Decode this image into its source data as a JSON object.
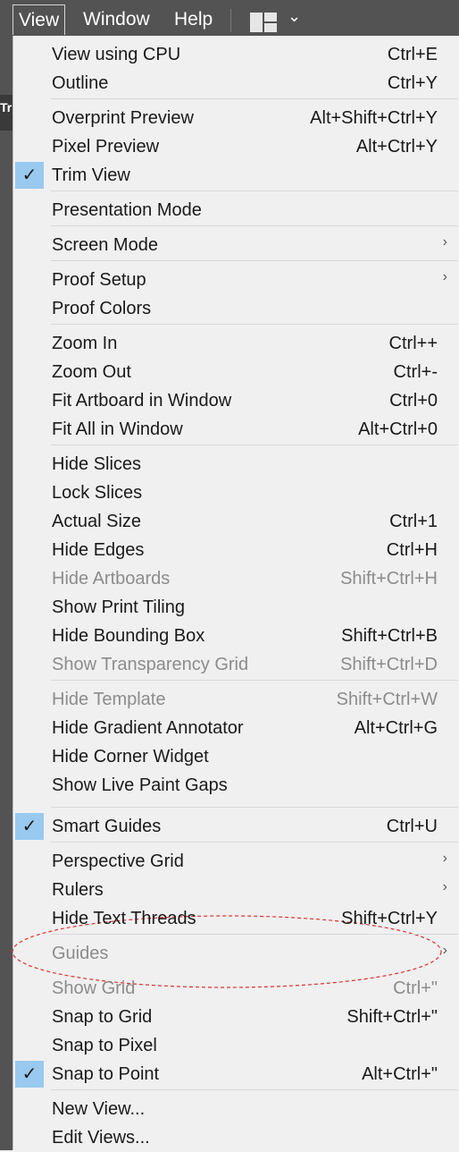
{
  "menubar": {
    "items": [
      "View",
      "Window",
      "Help"
    ],
    "workspace_chevron": "⌄"
  },
  "left_panel": {
    "text": "Tri"
  },
  "menu": {
    "items": [
      {
        "label": "View using CPU",
        "shortcut": "Ctrl+E",
        "checked": false,
        "disabled": false,
        "submenu": false
      },
      {
        "label": "Outline",
        "shortcut": "Ctrl+Y",
        "checked": false,
        "disabled": false,
        "submenu": false
      },
      {
        "label": "Overprint Preview",
        "shortcut": "Alt+Shift+Ctrl+Y",
        "checked": false,
        "disabled": false,
        "submenu": false
      },
      {
        "label": "Pixel Preview",
        "shortcut": "Alt+Ctrl+Y",
        "checked": false,
        "disabled": false,
        "submenu": false
      },
      {
        "label": "Trim View",
        "shortcut": "",
        "checked": true,
        "disabled": false,
        "submenu": false
      },
      {
        "label": "Presentation Mode",
        "shortcut": "",
        "checked": false,
        "disabled": false,
        "submenu": false
      },
      {
        "label": "Screen Mode",
        "shortcut": "",
        "checked": false,
        "disabled": false,
        "submenu": true
      },
      {
        "label": "Proof Setup",
        "shortcut": "",
        "checked": false,
        "disabled": false,
        "submenu": true
      },
      {
        "label": "Proof Colors",
        "shortcut": "",
        "checked": false,
        "disabled": false,
        "submenu": false
      },
      {
        "label": "Zoom In",
        "shortcut": "Ctrl++",
        "checked": false,
        "disabled": false,
        "submenu": false
      },
      {
        "label": "Zoom Out",
        "shortcut": "Ctrl+-",
        "checked": false,
        "disabled": false,
        "submenu": false
      },
      {
        "label": "Fit Artboard in Window",
        "shortcut": "Ctrl+0",
        "checked": false,
        "disabled": false,
        "submenu": false
      },
      {
        "label": "Fit All in Window",
        "shortcut": "Alt+Ctrl+0",
        "checked": false,
        "disabled": false,
        "submenu": false
      },
      {
        "label": "Hide Slices",
        "shortcut": "",
        "checked": false,
        "disabled": false,
        "submenu": false
      },
      {
        "label": "Lock Slices",
        "shortcut": "",
        "checked": false,
        "disabled": false,
        "submenu": false
      },
      {
        "label": "Actual Size",
        "shortcut": "Ctrl+1",
        "checked": false,
        "disabled": false,
        "submenu": false
      },
      {
        "label": "Hide Edges",
        "shortcut": "Ctrl+H",
        "checked": false,
        "disabled": false,
        "submenu": false
      },
      {
        "label": "Hide Artboards",
        "shortcut": "Shift+Ctrl+H",
        "checked": false,
        "disabled": true,
        "submenu": false
      },
      {
        "label": "Show Print Tiling",
        "shortcut": "",
        "checked": false,
        "disabled": false,
        "submenu": false
      },
      {
        "label": "Hide Bounding Box",
        "shortcut": "Shift+Ctrl+B",
        "checked": false,
        "disabled": false,
        "submenu": false
      },
      {
        "label": "Show Transparency Grid",
        "shortcut": "Shift+Ctrl+D",
        "checked": false,
        "disabled": true,
        "submenu": false
      },
      {
        "label": "Hide Template",
        "shortcut": "Shift+Ctrl+W",
        "checked": false,
        "disabled": true,
        "submenu": false
      },
      {
        "label": "Hide Gradient Annotator",
        "shortcut": "Alt+Ctrl+G",
        "checked": false,
        "disabled": false,
        "submenu": false
      },
      {
        "label": "Hide Corner Widget",
        "shortcut": "",
        "checked": false,
        "disabled": false,
        "submenu": false
      },
      {
        "label": "Show Live Paint Gaps",
        "shortcut": "",
        "checked": false,
        "disabled": false,
        "submenu": false
      },
      {
        "label": "Smart Guides",
        "shortcut": "Ctrl+U",
        "checked": true,
        "disabled": false,
        "submenu": false
      },
      {
        "label": "Perspective Grid",
        "shortcut": "",
        "checked": false,
        "disabled": false,
        "submenu": true
      },
      {
        "label": "Rulers",
        "shortcut": "",
        "checked": false,
        "disabled": false,
        "submenu": true
      },
      {
        "label": "Hide Text Threads",
        "shortcut": "Shift+Ctrl+Y",
        "checked": false,
        "disabled": false,
        "submenu": false
      },
      {
        "label": "Guides",
        "shortcut": "",
        "checked": false,
        "disabled": true,
        "submenu": true
      },
      {
        "label": "Show Grid",
        "shortcut": "Ctrl+\"",
        "checked": false,
        "disabled": true,
        "submenu": false
      },
      {
        "label": "Snap to Grid",
        "shortcut": "Shift+Ctrl+\"",
        "checked": false,
        "disabled": false,
        "submenu": false
      },
      {
        "label": "Snap to Pixel",
        "shortcut": "",
        "checked": false,
        "disabled": false,
        "submenu": false
      },
      {
        "label": "Snap to Point",
        "shortcut": "Alt+Ctrl+\"",
        "checked": true,
        "disabled": false,
        "submenu": false
      },
      {
        "label": "New View...",
        "shortcut": "",
        "checked": false,
        "disabled": false,
        "submenu": false
      },
      {
        "label": "Edit Views...",
        "shortcut": "",
        "checked": false,
        "disabled": false,
        "submenu": false
      }
    ],
    "check_glyph": "✓",
    "submenu_glyph": "›"
  },
  "colors": {
    "menubar_bg": "#535353",
    "menu_bg": "#f0f0f0",
    "check_bg": "#99c9ef",
    "disabled_text": "#8c8c8c",
    "annotation": "#e03030"
  }
}
